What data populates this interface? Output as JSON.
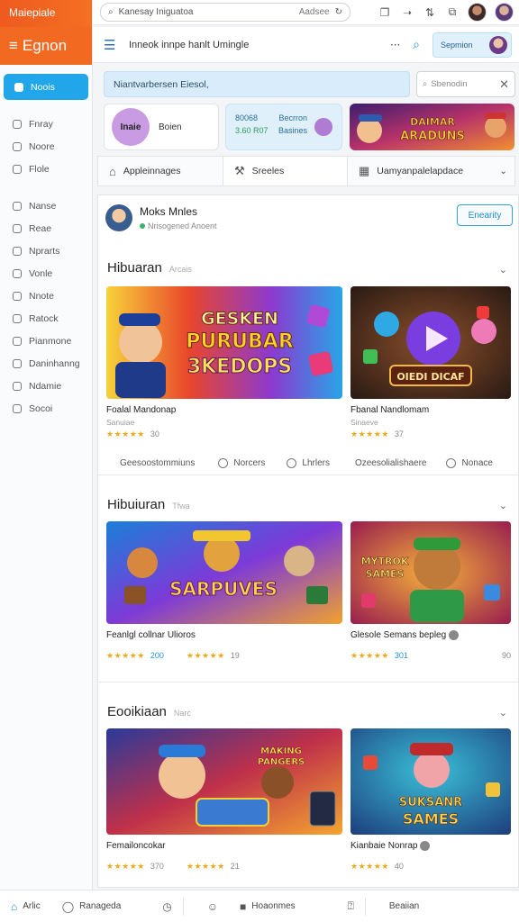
{
  "brand": {
    "top": "Maiepiale",
    "name": "Egnon"
  },
  "browser": {
    "url": "Kanesay Iniguatoa",
    "url_right": "Aadsee"
  },
  "toolbar": {
    "title": "Inneok  innpe  hanlt  Umingle",
    "profile_label": "Sepmion"
  },
  "sidebar": {
    "items": [
      {
        "label": "Noois",
        "icon": "home-icon",
        "active": true
      },
      {
        "label": "Fnray",
        "icon": "grid-icon"
      },
      {
        "label": "Noore",
        "icon": "home-outline-icon"
      },
      {
        "label": "Flole",
        "icon": "folder-icon"
      },
      {
        "label": "Nanse",
        "icon": "triangle-icon"
      },
      {
        "label": "Reae",
        "icon": "chat-icon"
      },
      {
        "label": "Nprarts",
        "icon": "chart-icon"
      },
      {
        "label": "Vonle",
        "icon": "clock-icon"
      },
      {
        "label": "Nnote",
        "icon": "note-icon"
      },
      {
        "label": "Ratock",
        "icon": "lock-icon"
      },
      {
        "label": "Pianmone",
        "icon": "search-icon"
      },
      {
        "label": "Daninhanng",
        "icon": "settings-icon"
      },
      {
        "label": "Ndamie",
        "icon": "user-icon"
      },
      {
        "label": "Socoi",
        "icon": "share-icon"
      }
    ]
  },
  "notice": {
    "text": "Niantvarbersen Eiesol,"
  },
  "side_search": {
    "placeholder": "Sbenodin"
  },
  "quick": {
    "card1_badge": "Inaie",
    "card1_label": "Boien",
    "card2_row1_a": "80068",
    "card2_row1_b": "Becrron",
    "card2_row2_a": "3.60 R07",
    "card2_row2_b": "Basines",
    "card3_title": "DAIMAR ARADUNS"
  },
  "tabs": [
    {
      "label": "Appleinnages",
      "icon": "puzzle-icon"
    },
    {
      "label": "Sreeles",
      "icon": "wrench-icon"
    },
    {
      "label": "Uamyanpalelapdace",
      "icon": "calendar-icon"
    }
  ],
  "profile": {
    "name": "Moks Mnles",
    "sub": "Nrisogened Anoent",
    "follow": "Enearity"
  },
  "sections": [
    {
      "title": "Hibuaran",
      "hint": "Arcais",
      "games": [
        {
          "title": "Foalal Mandonap",
          "sub": "Sanuiae",
          "stars": "★★★★★",
          "rating": "30",
          "art_text": "GESKEN PURUBAR 3KEDOPS"
        },
        {
          "title": "Fbanal Nandlomam",
          "sub": "Sinaeve",
          "stars": "★★★★★",
          "rating": "37",
          "art_text": "OIEDI DICAF"
        }
      ],
      "actions": [
        "Geesoostommiuns",
        "Norcers",
        "Lhrlers",
        "Ozeesolialishaere",
        "Nonace"
      ]
    },
    {
      "title": "Hibuiuran",
      "hint": "Tfwa",
      "games": [
        {
          "title": "Feanlgl collnar Ulioros",
          "stars": "★★★★★",
          "rating": "200",
          "stars2": "★★★★★",
          "rating2": "19",
          "art_text": "SARPUVES"
        },
        {
          "title": "Glesole Semans bepleg",
          "stars": "★★★★★",
          "rating": "301",
          "extra": "90",
          "art_text": "MYTROK SAMES"
        }
      ]
    },
    {
      "title": "Eooikiaan",
      "hint": "Narc",
      "games": [
        {
          "title": "Femailoncokar",
          "stars": "★★★★★",
          "rating": "370",
          "stars2": "★★★★★",
          "rating2": "21",
          "art_text": "MAKING PANGERS"
        },
        {
          "title": "Kianbaie Nonrap",
          "stars": "★★★★★",
          "rating": "40",
          "art_text": "SUKSANR SAMES"
        }
      ]
    }
  ],
  "bottom_nav": [
    {
      "label": "Arlic",
      "icon": "home-icon"
    },
    {
      "label": "Ranageda",
      "icon": "chat-icon"
    },
    {
      "label": "",
      "icon": "timer-icon"
    },
    {
      "label": "",
      "icon": "user-icon"
    },
    {
      "label": "Hoaonmes",
      "icon": "square-icon"
    },
    {
      "label": "",
      "icon": "help-icon"
    },
    {
      "label": "Beaiian",
      "icon": ""
    }
  ],
  "colors": {
    "accent": "#22a6ea",
    "brand": "#f26a22",
    "star": "#f0a91a"
  }
}
